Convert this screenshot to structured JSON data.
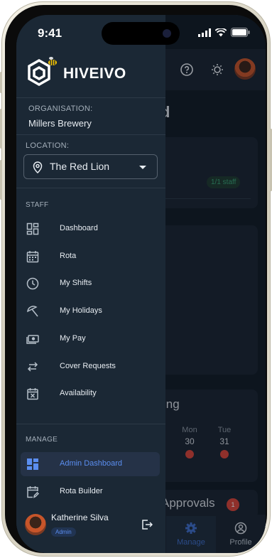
{
  "status_bar": {
    "time": "9:41"
  },
  "brand": {
    "name": "HIVEIVO"
  },
  "organisation": {
    "label": "ORGANISATION:",
    "name": "Millers Brewery"
  },
  "location": {
    "label": "LOCATION:",
    "selected": "The Red Lion"
  },
  "staff_section": {
    "label": "STAFF",
    "items": [
      {
        "label": "Dashboard",
        "icon": "dashboard-icon"
      },
      {
        "label": "Rota",
        "icon": "calendar-icon"
      },
      {
        "label": "My Shifts",
        "icon": "clock-icon"
      },
      {
        "label": "My Holidays",
        "icon": "beach-umbrella-icon"
      },
      {
        "label": "My Pay",
        "icon": "money-icon"
      },
      {
        "label": "Cover Requests",
        "icon": "swap-icon"
      },
      {
        "label": "Availability",
        "icon": "calendar-x-icon"
      }
    ]
  },
  "manage_section": {
    "label": "MANAGE",
    "items": [
      {
        "label": "Admin Dashboard",
        "icon": "grid-icon",
        "active": true
      },
      {
        "label": "Rota Builder",
        "icon": "edit-calendar-icon"
      }
    ]
  },
  "user": {
    "name": "Katherine Silva",
    "role": "Admin"
  },
  "background": {
    "page_title_partial": "d",
    "staff_badge": "1/1 staff",
    "schedule_title_partial": "ing",
    "days": [
      {
        "label": "Mon",
        "num": "30"
      },
      {
        "label": "Tue",
        "num": "31"
      }
    ],
    "approvals_title_partial": "Approvals",
    "approvals_count": "1",
    "tabs": [
      {
        "label": "Manage",
        "icon": "gear-icon",
        "active": true
      },
      {
        "label": "Profile",
        "icon": "profile-icon"
      }
    ]
  },
  "colors": {
    "accent": "#5b8ef0",
    "drawer_bg": "#1b2835",
    "danger": "#d9453a",
    "success": "#3aa476",
    "brand_yellow": "#f5c400"
  }
}
